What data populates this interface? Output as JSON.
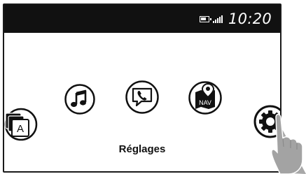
{
  "status_bar": {
    "time": "10:20",
    "battery_icon": "battery-icon",
    "signal_icon": "signal-bars-icon"
  },
  "apps": [
    {
      "id": "apps",
      "icon": "apps-stack-icon",
      "letter": "A"
    },
    {
      "id": "music",
      "icon": "music-note-icon"
    },
    {
      "id": "phone",
      "icon": "phone-bubble-icon"
    },
    {
      "id": "navigation",
      "icon": "navigation-map-icon",
      "text": "NAV"
    },
    {
      "id": "settings",
      "icon": "gear-icon",
      "selected": true
    }
  ],
  "selected_label": "Réglages"
}
